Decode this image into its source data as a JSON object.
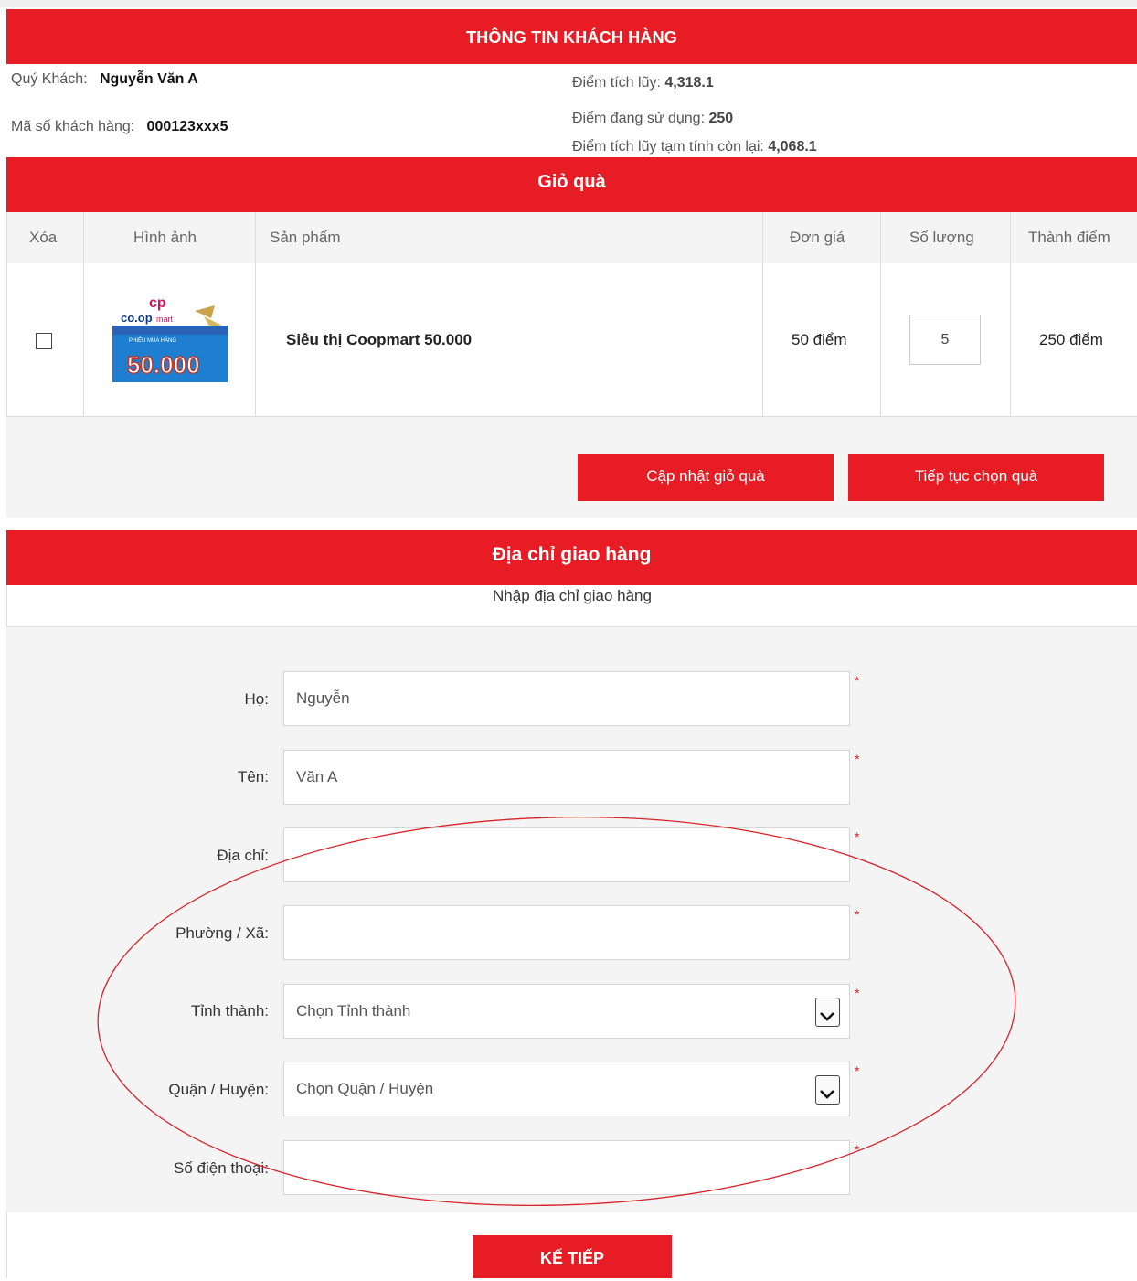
{
  "customer_info": {
    "title": "THÔNG TIN KHÁCH HÀNG",
    "name_label": "Quý Khách:",
    "name_value": "Nguyễn Văn A",
    "id_label": "Mã số khách hàng:",
    "id_value": "000123xxx5",
    "points_label": "Điểm tích lũy:",
    "points_value": "4,318.1",
    "using_label": "Điểm đang sử dụng:",
    "using_value": "250",
    "remaining_label": "Điểm tích lũy tạm tính còn lại:",
    "remaining_value": "4,068.1"
  },
  "cart": {
    "title": "Giỏ quà",
    "columns": {
      "delete": "Xóa",
      "image": "Hình ảnh",
      "product": "Sản phẩm",
      "unit_price": "Đơn giá",
      "quantity": "Số lượng",
      "total": "Thành điểm"
    },
    "items": [
      {
        "product": "Siêu thị Coopmart 50.000",
        "unit_price": "50 điểm",
        "quantity": "5",
        "total": "250 điểm",
        "image_alt": "coupon-voucher-image",
        "voucher_brand": "co.op",
        "voucher_brand_small": "mart",
        "voucher_caption": "PHIẾU MUA HÀNG",
        "voucher_amount": "50.000"
      }
    ],
    "update_button": "Cập nhật giỏ quà",
    "continue_button": "Tiếp tục chọn quà"
  },
  "shipping": {
    "title": "Địa chỉ giao hàng",
    "subtitle": "Nhập địa chỉ giao hàng",
    "fields": {
      "last_name_label": "Họ:",
      "last_name_value": "Nguyễn",
      "first_name_label": "Tên:",
      "first_name_value": "Văn A",
      "address_label": "Địa chỉ:",
      "ward_label": "Phường / Xã:",
      "province_label": "Tỉnh thành:",
      "province_value": "Chọn Tỉnh thành",
      "district_label": "Quận / Huyện:",
      "district_value": "Chọn Quận / Huyện",
      "phone_label": "Số điện thoại:"
    },
    "required_mark": "*",
    "next_button": "KẾ TIẾP"
  },
  "colors": {
    "brand_red": "#e81c24",
    "panel_gray": "#f4f4f4",
    "annotation_red": "#d8232a"
  }
}
